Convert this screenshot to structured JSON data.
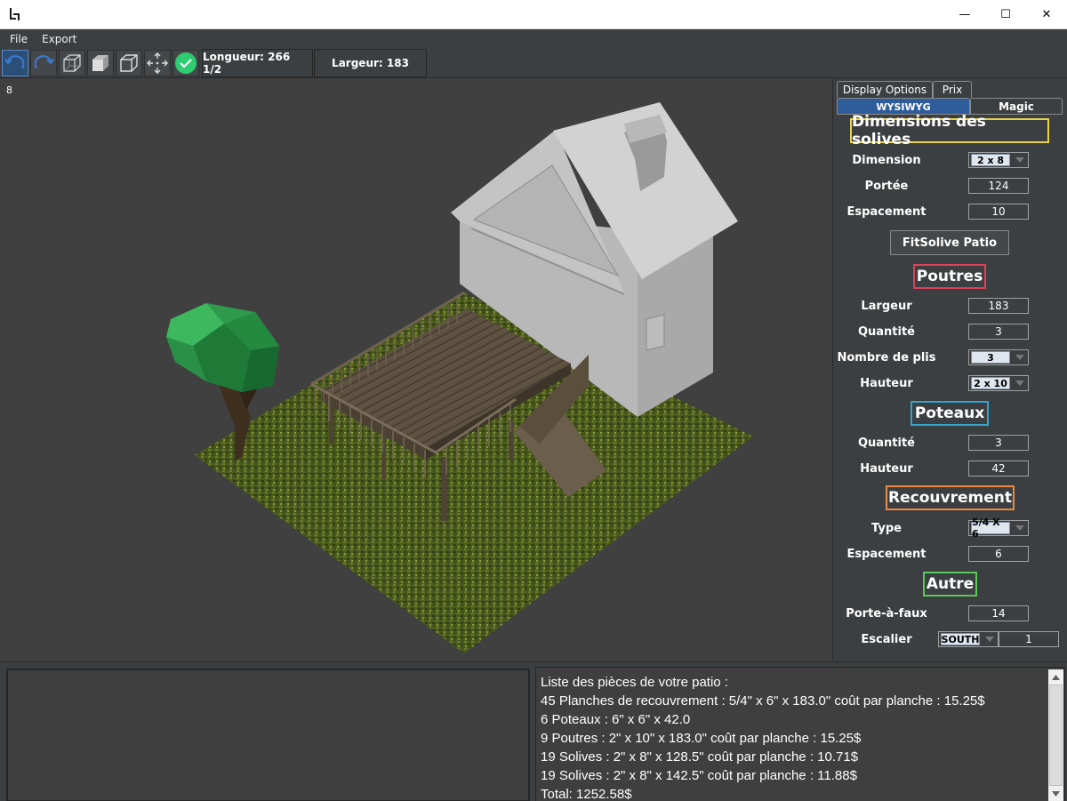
{
  "window": {
    "minimize_glyph": "—",
    "maximize_glyph": "☐",
    "close_glyph": "✕"
  },
  "menu": {
    "file": "File",
    "export": "Export"
  },
  "toolbar": {
    "icons": [
      "undo-icon",
      "redo-icon",
      "wireframe-cube-icon",
      "solid-cube-icon",
      "outline-cube-icon",
      "move-arrows-icon",
      "confirm-check-icon"
    ],
    "longueur": "Longueur: 266 1/2",
    "largeur": "Largeur: 183"
  },
  "viewport": {
    "fps": "8"
  },
  "panel": {
    "tabs": {
      "display_options": "Display Options",
      "prix": "Prix",
      "wysiwyg": "WYSIWYG",
      "magic": "Magic"
    },
    "solives": {
      "title": "Dimensions des solives",
      "title_color": "#e8d24a",
      "dimension_label": "Dimension",
      "dimension_value": "2 x 8",
      "portee_label": "Portée",
      "portee_value": "124",
      "espacement_label": "Espacement",
      "espacement_value": "10",
      "fit_button": "FitSolive Patio"
    },
    "poutres": {
      "title": "Poutres",
      "title_color": "#d9425a",
      "largeur_label": "Largeur",
      "largeur_value": "183",
      "quantite_label": "Quantité",
      "quantite_value": "3",
      "plis_label": "Nombre de plis",
      "plis_value": "3",
      "hauteur_label": "Hauteur",
      "hauteur_value": "2 x 10"
    },
    "poteaux": {
      "title": "Poteaux",
      "title_color": "#35a3c8",
      "quantite_label": "Quantité",
      "quantite_value": "3",
      "hauteur_label": "Hauteur",
      "hauteur_value": "42"
    },
    "recouvrement": {
      "title": "Recouvrement",
      "title_color": "#f0893c",
      "type_label": "Type",
      "type_value": "5/4 X 6",
      "espacement_label": "Espacement",
      "espacement_value": "6"
    },
    "autre": {
      "title": "Autre",
      "title_color": "#5cc85a",
      "porte_label": "Porte-à-faux",
      "porte_value": "14",
      "escalier_label": "Escalier",
      "escalier_dir": "SOUTH",
      "escalier_value": "1"
    }
  },
  "parts": {
    "lines": [
      "Liste des pièces de votre patio :",
      "45 Planches de recouvrement : 5/4\" x 6\" x 183.0\" coût par planche : 15.25$",
      "6 Poteaux :  6\" x 6\" x 42.0",
      "9 Poutres :  2\" x 10\" x 183.0\" coût par planche : 15.25$",
      "19 Solives :  2\" x 8\" x 128.5\" coût par planche : 10.71$",
      "19 Solives :  2\" x 8\" x 142.5\" coût par planche : 11.88$",
      "Total:  1252.58$"
    ]
  }
}
